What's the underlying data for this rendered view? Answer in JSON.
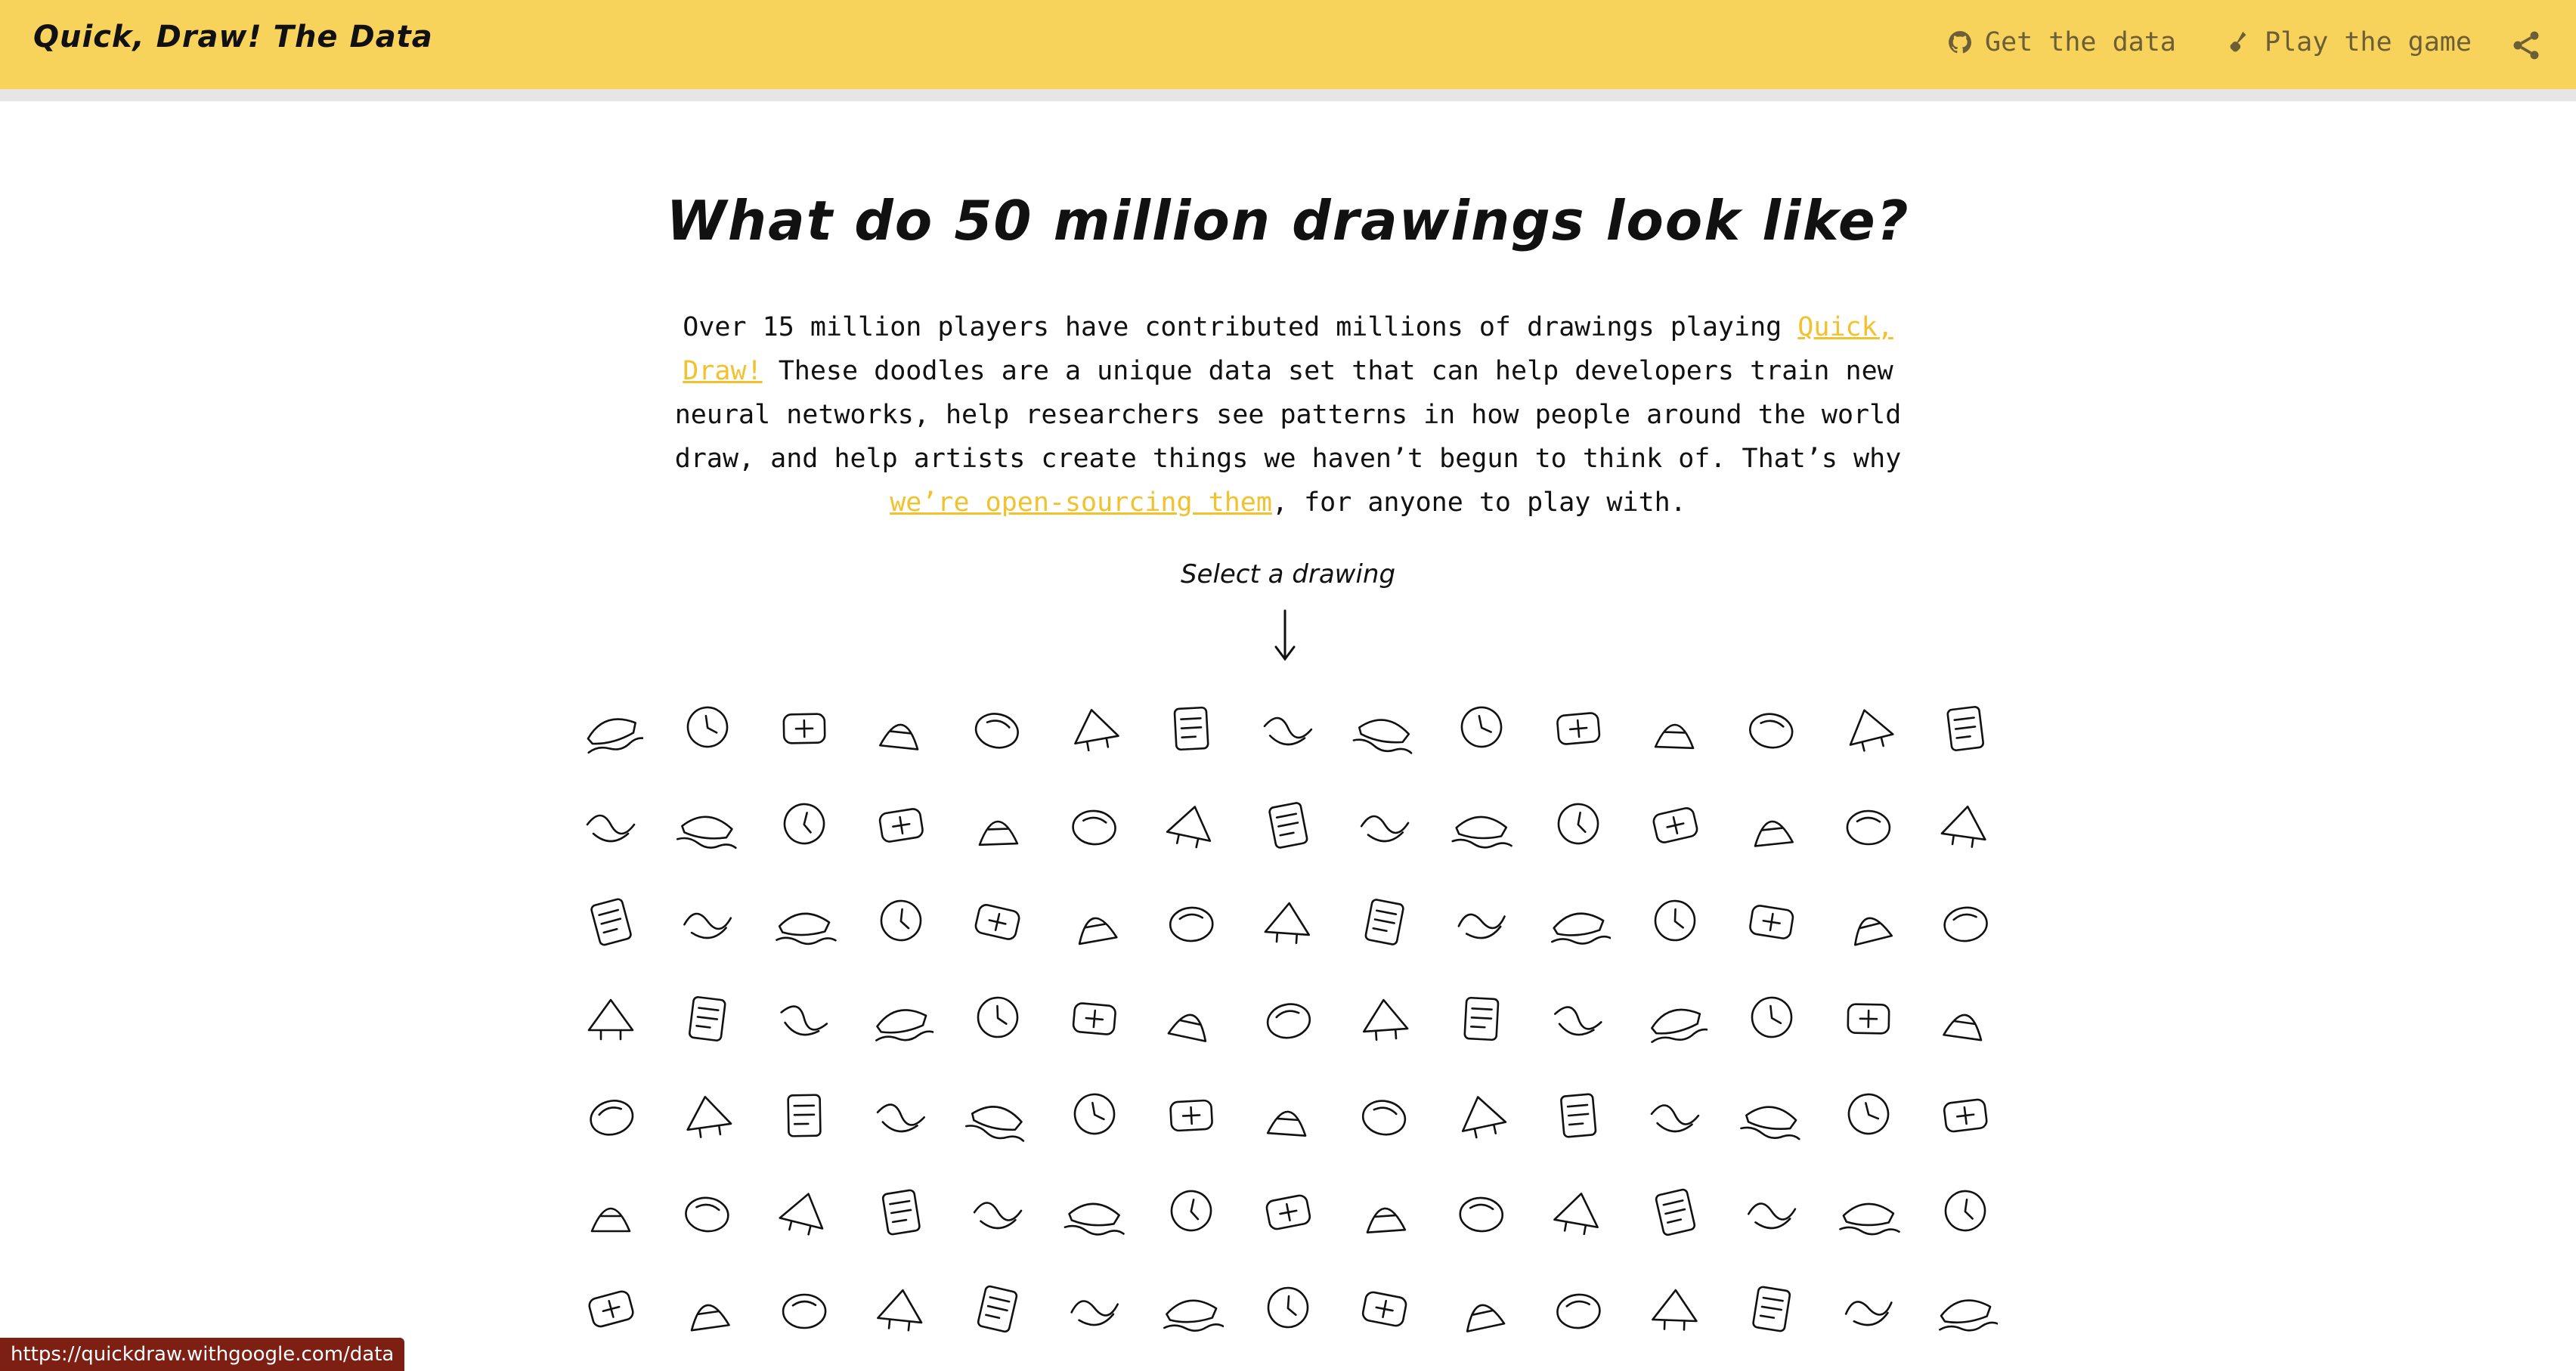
{
  "header": {
    "title": "Quick, Draw! The Data",
    "get_data_label": "Get the data",
    "play_game_label": "Play the game"
  },
  "hero": {
    "headline": "What do 50 million drawings look like?",
    "intro_text_1": "Over 15 million players have contributed millions of drawings playing ",
    "intro_link_1": "Quick, Draw!",
    "intro_text_2": " These doodles are a unique data set that can help developers train new neural networks, help researchers see patterns in how people around the world draw, and help artists create things we haven’t begun to think of. That’s why ",
    "intro_link_2": "we’re open-sourcing them",
    "intro_text_3": ", for anyone to play with.",
    "select_label": "Select a drawing"
  },
  "drawings": [
    "aircraft-carrier-icon",
    "airplane-icon",
    "alarm-clock-icon",
    "ambulance-icon",
    "angel-icon",
    "animal-migration-icon",
    "ant-icon",
    "anvil-icon",
    "apple-icon",
    "arm-icon",
    "asparagus-icon",
    "axe-icon",
    "backpack-icon",
    "banana-icon",
    "bandage-icon",
    "barn-icon",
    "baseball-icon",
    "baseball-bat-icon",
    "basket-icon",
    "basketball-icon",
    "bat-icon",
    "bathtub-icon",
    "beach-icon",
    "bear-icon",
    "beard-icon",
    "bed-icon",
    "bee-icon",
    "belt-icon",
    "bench-icon",
    "bicycle-icon",
    "binoculars-icon",
    "bird-icon",
    "birthday-cake-icon",
    "blackberry-icon",
    "blueberry-icon",
    "book-icon",
    "boomerang-icon",
    "bottlecap-icon",
    "bowtie-icon",
    "bracelet-icon",
    "brain-icon",
    "bread-icon",
    "bridge-icon",
    "broccoli-icon",
    "broom-icon",
    "bucket-icon",
    "bulldozer-icon",
    "bus-icon",
    "bush-icon",
    "butterfly-icon",
    "cactus-icon",
    "cake-icon",
    "calculator-icon",
    "calendar-icon",
    "camel-icon",
    "camera-icon",
    "camouflage-icon",
    "campfire-icon",
    "candle-icon",
    "cannon-icon",
    "canoe-icon",
    "car-icon",
    "carrot-icon",
    "castle-icon",
    "cat-icon",
    "ceiling-fan-icon",
    "cello-icon",
    "cell-phone-icon",
    "chair-icon",
    "chandelier-icon",
    "church-icon",
    "circle-icon",
    "clarinet-icon",
    "clock-icon",
    "cloud-icon",
    "coffee-cup-icon",
    "compass-icon",
    "computer-icon",
    "cookie-icon",
    "cooler-icon",
    "couch-icon",
    "cow-icon",
    "crab-icon",
    "crayon-icon",
    "crocodile-icon",
    "crown-icon",
    "cruise-ship-icon",
    "cup-icon",
    "diamond-icon",
    "dishwasher-icon",
    "diving-board-icon",
    "dog-icon",
    "dolphin-icon",
    "donut-icon",
    "door-icon",
    "dragon-icon",
    "dresser-icon",
    "drill-icon",
    "drums-icon",
    "duck-icon",
    "dumbbell-icon",
    "ear-icon",
    "elbow-icon",
    "elephant-icon",
    "envelope-icon"
  ],
  "status_bar": {
    "url": "https://quickdraw.withgoogle.com/data"
  }
}
